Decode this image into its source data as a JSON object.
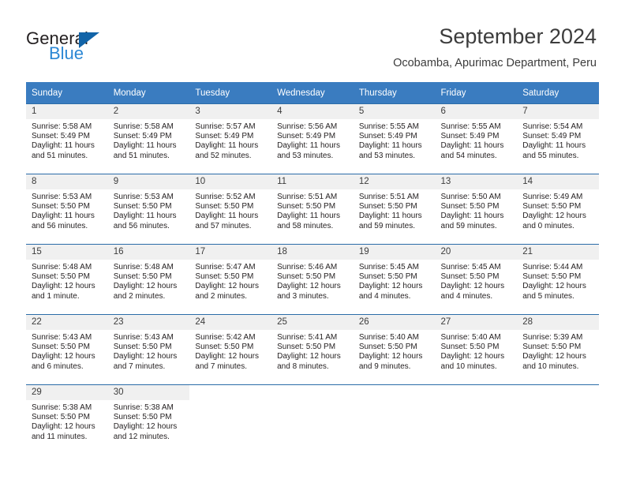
{
  "brand": {
    "name_part1": "General",
    "name_part2": "Blue",
    "triangle_icon": "triangle-logo-icon",
    "accent_color": "#2b87d4",
    "logo_dark_color": "#231f20"
  },
  "header": {
    "title": "September 2024",
    "subtitle": "Ocobamba, Apurimac Department, Peru"
  },
  "calendar": {
    "header_bg": "#3a7cc0",
    "header_text_color": "#ffffff",
    "daynum_bg": "#f0f0f0",
    "row_border_color": "#2b6ca8",
    "weekday_headers": [
      "Sunday",
      "Monday",
      "Tuesday",
      "Wednesday",
      "Thursday",
      "Friday",
      "Saturday"
    ],
    "weeks": [
      [
        {
          "day": "1",
          "sunrise": "Sunrise: 5:58 AM",
          "sunset": "Sunset: 5:49 PM",
          "daylight": "Daylight: 11 hours and 51 minutes."
        },
        {
          "day": "2",
          "sunrise": "Sunrise: 5:58 AM",
          "sunset": "Sunset: 5:49 PM",
          "daylight": "Daylight: 11 hours and 51 minutes."
        },
        {
          "day": "3",
          "sunrise": "Sunrise: 5:57 AM",
          "sunset": "Sunset: 5:49 PM",
          "daylight": "Daylight: 11 hours and 52 minutes."
        },
        {
          "day": "4",
          "sunrise": "Sunrise: 5:56 AM",
          "sunset": "Sunset: 5:49 PM",
          "daylight": "Daylight: 11 hours and 53 minutes."
        },
        {
          "day": "5",
          "sunrise": "Sunrise: 5:55 AM",
          "sunset": "Sunset: 5:49 PM",
          "daylight": "Daylight: 11 hours and 53 minutes."
        },
        {
          "day": "6",
          "sunrise": "Sunrise: 5:55 AM",
          "sunset": "Sunset: 5:49 PM",
          "daylight": "Daylight: 11 hours and 54 minutes."
        },
        {
          "day": "7",
          "sunrise": "Sunrise: 5:54 AM",
          "sunset": "Sunset: 5:49 PM",
          "daylight": "Daylight: 11 hours and 55 minutes."
        }
      ],
      [
        {
          "day": "8",
          "sunrise": "Sunrise: 5:53 AM",
          "sunset": "Sunset: 5:50 PM",
          "daylight": "Daylight: 11 hours and 56 minutes."
        },
        {
          "day": "9",
          "sunrise": "Sunrise: 5:53 AM",
          "sunset": "Sunset: 5:50 PM",
          "daylight": "Daylight: 11 hours and 56 minutes."
        },
        {
          "day": "10",
          "sunrise": "Sunrise: 5:52 AM",
          "sunset": "Sunset: 5:50 PM",
          "daylight": "Daylight: 11 hours and 57 minutes."
        },
        {
          "day": "11",
          "sunrise": "Sunrise: 5:51 AM",
          "sunset": "Sunset: 5:50 PM",
          "daylight": "Daylight: 11 hours and 58 minutes."
        },
        {
          "day": "12",
          "sunrise": "Sunrise: 5:51 AM",
          "sunset": "Sunset: 5:50 PM",
          "daylight": "Daylight: 11 hours and 59 minutes."
        },
        {
          "day": "13",
          "sunrise": "Sunrise: 5:50 AM",
          "sunset": "Sunset: 5:50 PM",
          "daylight": "Daylight: 11 hours and 59 minutes."
        },
        {
          "day": "14",
          "sunrise": "Sunrise: 5:49 AM",
          "sunset": "Sunset: 5:50 PM",
          "daylight": "Daylight: 12 hours and 0 minutes."
        }
      ],
      [
        {
          "day": "15",
          "sunrise": "Sunrise: 5:48 AM",
          "sunset": "Sunset: 5:50 PM",
          "daylight": "Daylight: 12 hours and 1 minute."
        },
        {
          "day": "16",
          "sunrise": "Sunrise: 5:48 AM",
          "sunset": "Sunset: 5:50 PM",
          "daylight": "Daylight: 12 hours and 2 minutes."
        },
        {
          "day": "17",
          "sunrise": "Sunrise: 5:47 AM",
          "sunset": "Sunset: 5:50 PM",
          "daylight": "Daylight: 12 hours and 2 minutes."
        },
        {
          "day": "18",
          "sunrise": "Sunrise: 5:46 AM",
          "sunset": "Sunset: 5:50 PM",
          "daylight": "Daylight: 12 hours and 3 minutes."
        },
        {
          "day": "19",
          "sunrise": "Sunrise: 5:45 AM",
          "sunset": "Sunset: 5:50 PM",
          "daylight": "Daylight: 12 hours and 4 minutes."
        },
        {
          "day": "20",
          "sunrise": "Sunrise: 5:45 AM",
          "sunset": "Sunset: 5:50 PM",
          "daylight": "Daylight: 12 hours and 4 minutes."
        },
        {
          "day": "21",
          "sunrise": "Sunrise: 5:44 AM",
          "sunset": "Sunset: 5:50 PM",
          "daylight": "Daylight: 12 hours and 5 minutes."
        }
      ],
      [
        {
          "day": "22",
          "sunrise": "Sunrise: 5:43 AM",
          "sunset": "Sunset: 5:50 PM",
          "daylight": "Daylight: 12 hours and 6 minutes."
        },
        {
          "day": "23",
          "sunrise": "Sunrise: 5:43 AM",
          "sunset": "Sunset: 5:50 PM",
          "daylight": "Daylight: 12 hours and 7 minutes."
        },
        {
          "day": "24",
          "sunrise": "Sunrise: 5:42 AM",
          "sunset": "Sunset: 5:50 PM",
          "daylight": "Daylight: 12 hours and 7 minutes."
        },
        {
          "day": "25",
          "sunrise": "Sunrise: 5:41 AM",
          "sunset": "Sunset: 5:50 PM",
          "daylight": "Daylight: 12 hours and 8 minutes."
        },
        {
          "day": "26",
          "sunrise": "Sunrise: 5:40 AM",
          "sunset": "Sunset: 5:50 PM",
          "daylight": "Daylight: 12 hours and 9 minutes."
        },
        {
          "day": "27",
          "sunrise": "Sunrise: 5:40 AM",
          "sunset": "Sunset: 5:50 PM",
          "daylight": "Daylight: 12 hours and 10 minutes."
        },
        {
          "day": "28",
          "sunrise": "Sunrise: 5:39 AM",
          "sunset": "Sunset: 5:50 PM",
          "daylight": "Daylight: 12 hours and 10 minutes."
        }
      ],
      [
        {
          "day": "29",
          "sunrise": "Sunrise: 5:38 AM",
          "sunset": "Sunset: 5:50 PM",
          "daylight": "Daylight: 12 hours and 11 minutes."
        },
        {
          "day": "30",
          "sunrise": "Sunrise: 5:38 AM",
          "sunset": "Sunset: 5:50 PM",
          "daylight": "Daylight: 12 hours and 12 minutes."
        },
        {
          "day": "",
          "sunrise": "",
          "sunset": "",
          "daylight": ""
        },
        {
          "day": "",
          "sunrise": "",
          "sunset": "",
          "daylight": ""
        },
        {
          "day": "",
          "sunrise": "",
          "sunset": "",
          "daylight": ""
        },
        {
          "day": "",
          "sunrise": "",
          "sunset": "",
          "daylight": ""
        },
        {
          "day": "",
          "sunrise": "",
          "sunset": "",
          "daylight": ""
        }
      ]
    ]
  }
}
